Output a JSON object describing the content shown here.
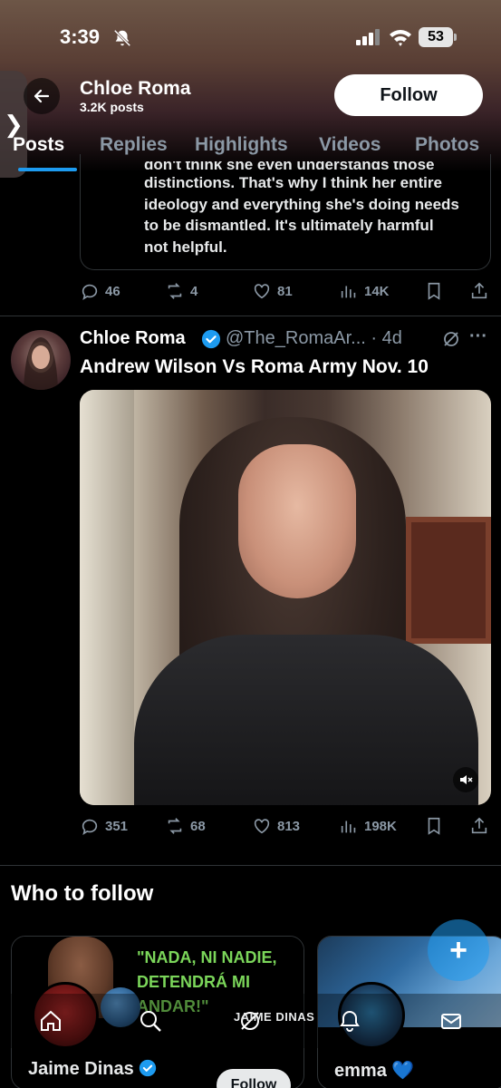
{
  "status_bar": {
    "time": "3:39",
    "battery": "53"
  },
  "header": {
    "name": "Chloe Roma",
    "posts": "3.2K posts",
    "follow_label": "Follow",
    "side_tab": "❯"
  },
  "tabs": [
    "Posts",
    "Replies",
    "Highlights",
    "Videos",
    "Photos"
  ],
  "quoted_post": {
    "text_cut": "don't think she even understands those",
    "lines": [
      "distinctions. That's why I think her entire",
      "ideology and everything she's doing needs",
      "to be dismantled. It's ultimately harmful",
      "not helpful."
    ],
    "replies": "46",
    "reposts": "4",
    "likes": "81",
    "views": "14K"
  },
  "post": {
    "name": "Chloe Roma",
    "handle_time": "@The_RomaAr... · 4d",
    "more": "···",
    "title": "Andrew Wilson Vs Roma Army Nov. 10",
    "replies": "351",
    "reposts": "68",
    "likes": "813",
    "views": "198K"
  },
  "who_to_follow": {
    "title": "Who to follow",
    "cards": [
      {
        "name": "Jaime Dinas",
        "banner_quote": "\"NADA, NI NADIE,\nDETENDRÁ MI ANDAR!\"",
        "follow_label": "Follow"
      },
      {
        "name": "emma 💙"
      }
    ]
  },
  "bottom_nav": {
    "label": "JAIME DINAS"
  },
  "fab_label": "+",
  "colors": {
    "accent": "#1d9bf0",
    "muted": "#8b98a5",
    "quote_green": "#7bd65a"
  }
}
